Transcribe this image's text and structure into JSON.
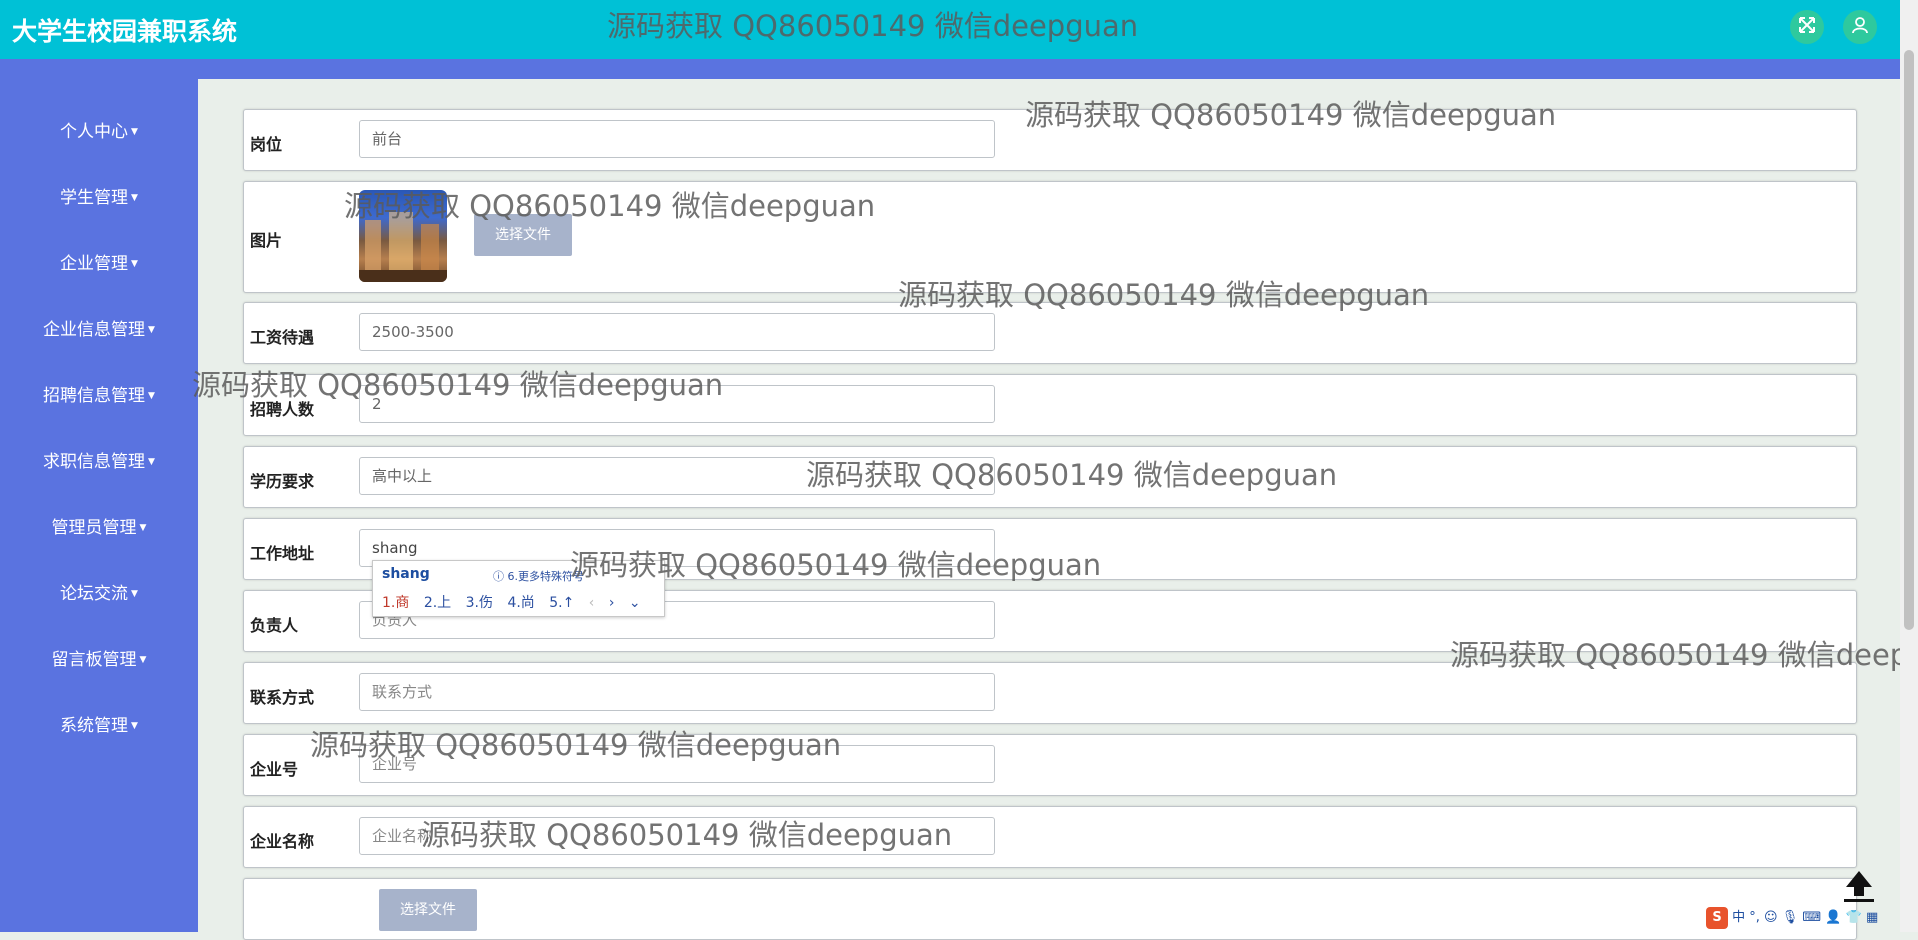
{
  "header": {
    "title": "大学生校园兼职系统"
  },
  "sidebar": {
    "items": [
      {
        "label": "个人中心"
      },
      {
        "label": "学生管理"
      },
      {
        "label": "企业管理"
      },
      {
        "label": "企业信息管理"
      },
      {
        "label": "招聘信息管理"
      },
      {
        "label": "求职信息管理"
      },
      {
        "label": "管理员管理"
      },
      {
        "label": "论坛交流"
      },
      {
        "label": "留言板管理"
      },
      {
        "label": "系统管理"
      }
    ]
  },
  "form": {
    "position": {
      "label": "岗位",
      "value": "前台"
    },
    "image": {
      "label": "图片",
      "button": "选择文件"
    },
    "salary": {
      "label": "工资待遇",
      "value": "2500-3500"
    },
    "headcount": {
      "label": "招聘人数",
      "value": "2"
    },
    "education": {
      "label": "学历要求",
      "value": "高中以上"
    },
    "address": {
      "label": "工作地址",
      "value": "shang"
    },
    "manager": {
      "label": "负责人",
      "placeholder": "负责人"
    },
    "contact": {
      "label": "联系方式",
      "placeholder": "联系方式"
    },
    "company_no": {
      "label": "企业号",
      "placeholder": "企业号"
    },
    "company_name": {
      "label": "企业名称",
      "placeholder": "企业名称"
    },
    "file": {
      "button": "选择文件"
    }
  },
  "ime": {
    "composition": "shang",
    "hint": "6.更多特殊符号",
    "candidates": [
      "1.商",
      "2.上",
      "3.伤",
      "4.尚",
      "5.↑"
    ]
  },
  "watermark": "源码获取 QQ86050149 微信deepguan",
  "taskbar": {
    "text": "中 °,"
  },
  "colors": {
    "header": "#00c1d6",
    "sidebar": "#5a73e0",
    "file_button": "#a7b3cb"
  }
}
